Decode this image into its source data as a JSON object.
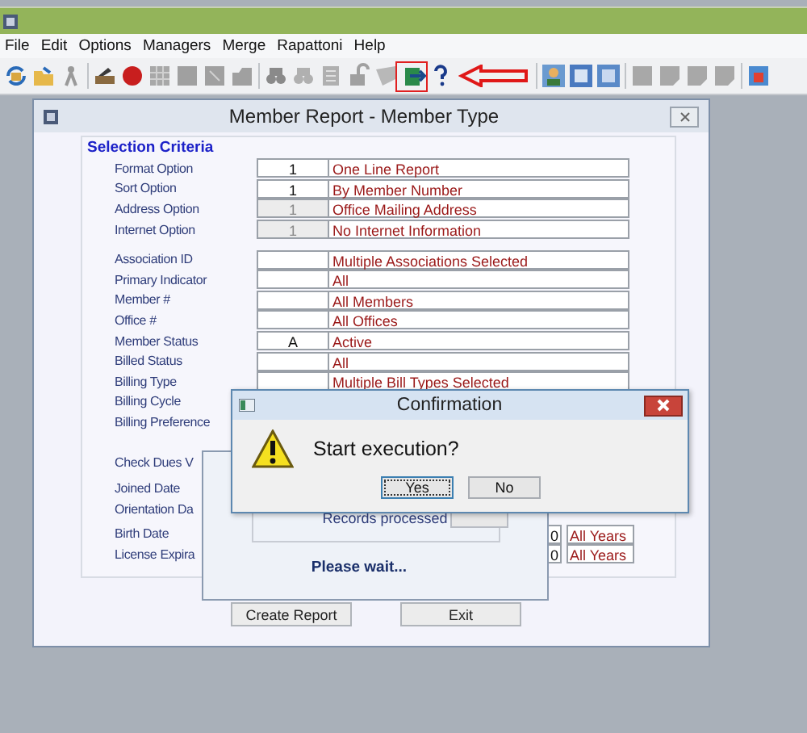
{
  "menu": [
    "File",
    "Edit",
    "Options",
    "Managers",
    "Merge",
    "Rapattoni",
    "Help"
  ],
  "report_window": {
    "title": "Member Report - Member Type",
    "group_title": "Selection Criteria",
    "sections": [
      [
        {
          "kind": "criteria",
          "label": "Format Option",
          "code": "1",
          "description": "One Line Report",
          "disabled": false
        },
        {
          "kind": "criteria",
          "label": "Sort Option",
          "code": "1",
          "description": "By Member Number",
          "disabled": false
        },
        {
          "kind": "criteria",
          "label": "Address Option",
          "code": "1",
          "description": "Office Mailing Address",
          "disabled": true
        },
        {
          "kind": "criteria",
          "label": "Internet Option",
          "code": "1",
          "description": "No Internet Information",
          "disabled": true
        }
      ],
      [
        {
          "kind": "criteria",
          "label": "Association ID",
          "description": "Multiple Associations Selected",
          "disabled": false
        },
        {
          "kind": "criteria",
          "label": "Primary Indicator",
          "description": "All",
          "disabled": false
        },
        {
          "kind": "criteria",
          "label": "Member #",
          "description": "All Members",
          "disabled": false
        },
        {
          "kind": "criteria",
          "label": "Office #",
          "description": "All Offices",
          "disabled": false
        },
        {
          "kind": "criteria",
          "label": "Member Status",
          "code": "A",
          "description": "Active",
          "disabled": false
        },
        {
          "kind": "criteria",
          "label": "Billed Status",
          "description": "All",
          "disabled": false
        },
        {
          "kind": "criteria",
          "label": "Billing Type",
          "description": "Multiple Bill Types Selected",
          "disabled": false
        },
        {
          "kind": "label",
          "label": "Billing Cycle"
        },
        {
          "kind": "label",
          "label": "Billing Preference"
        }
      ],
      [
        {
          "kind": "label",
          "label": "Check Dues V"
        }
      ],
      [
        {
          "kind": "label",
          "label": "Joined Date"
        },
        {
          "kind": "label",
          "label": "Orientation Da"
        }
      ],
      [
        {
          "kind": "date",
          "label": "Birth Date",
          "code": "0",
          "description": "All Years"
        },
        {
          "kind": "date",
          "label": "License Expira",
          "code": "0",
          "description": "All Years"
        }
      ]
    ],
    "buttons": [
      "Create Report",
      "Exit"
    ]
  },
  "progress_dialog": {
    "records_label": "Records processed",
    "message": "Please wait..."
  },
  "confirmation": {
    "title": "Confirmation",
    "message": "Start execution?",
    "buttons": [
      {
        "label": "Yes",
        "selected": true
      },
      {
        "label": "No",
        "selected": false
      }
    ]
  }
}
